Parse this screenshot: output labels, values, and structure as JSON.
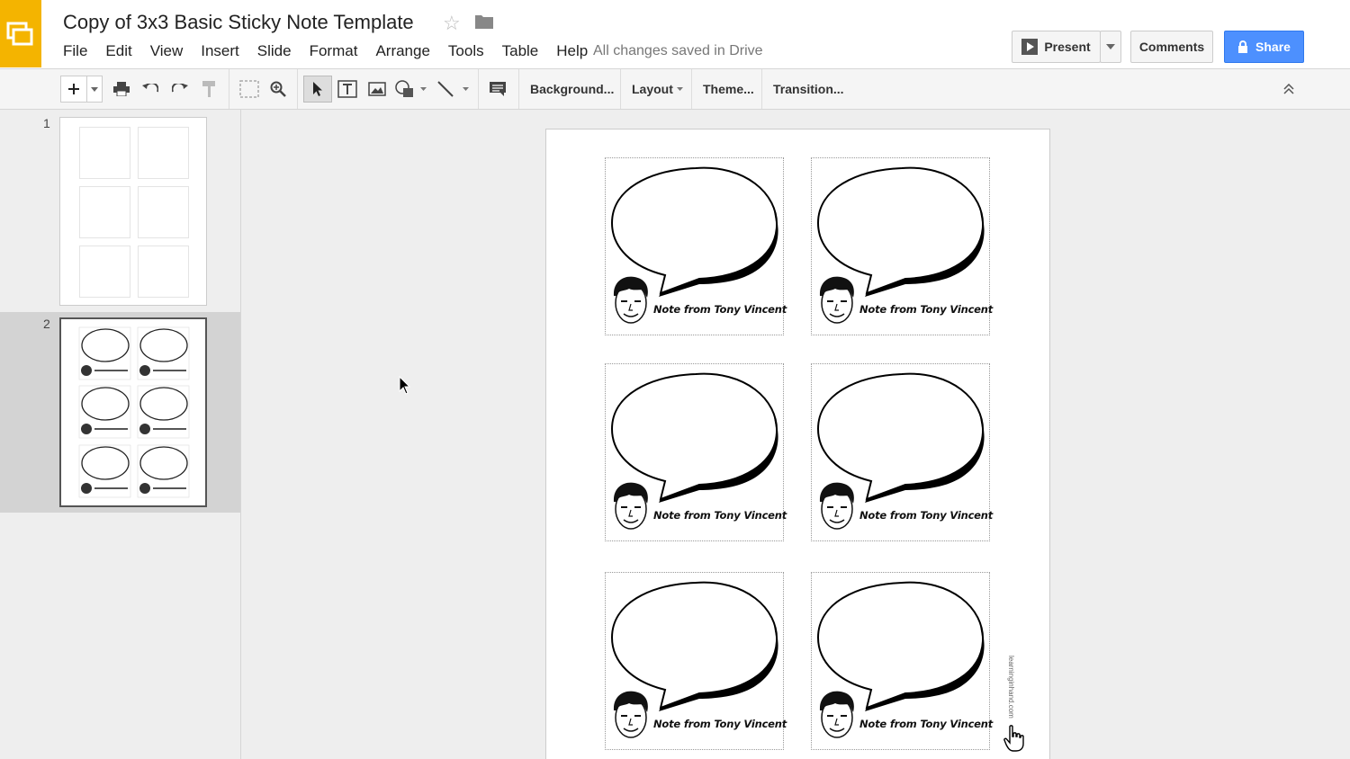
{
  "header": {
    "doc_title": "Copy of 3x3 Basic Sticky Note Template",
    "menus": [
      "File",
      "Edit",
      "View",
      "Insert",
      "Slide",
      "Format",
      "Arrange",
      "Tools",
      "Table",
      "Help"
    ],
    "saved_status": "All changes saved in Drive",
    "present_label": "Present",
    "comments_label": "Comments",
    "share_label": "Share"
  },
  "toolbar": {
    "background_label": "Background...",
    "layout_label": "Layout",
    "theme_label": "Theme...",
    "transition_label": "Transition..."
  },
  "filmstrip": {
    "slides": [
      {
        "number": "1"
      },
      {
        "number": "2"
      }
    ],
    "selected": "2"
  },
  "slide": {
    "notes": [
      {
        "label": "Note from Tony Vincent"
      },
      {
        "label": "Note from Tony Vincent"
      },
      {
        "label": "Note from Tony Vincent"
      },
      {
        "label": "Note from Tony Vincent"
      },
      {
        "label": "Note from Tony Vincent"
      },
      {
        "label": "Note from Tony Vincent"
      }
    ],
    "watermark": "learninginhand.com"
  },
  "colors": {
    "logo": "#f4b400",
    "share": "#4d90fe"
  }
}
